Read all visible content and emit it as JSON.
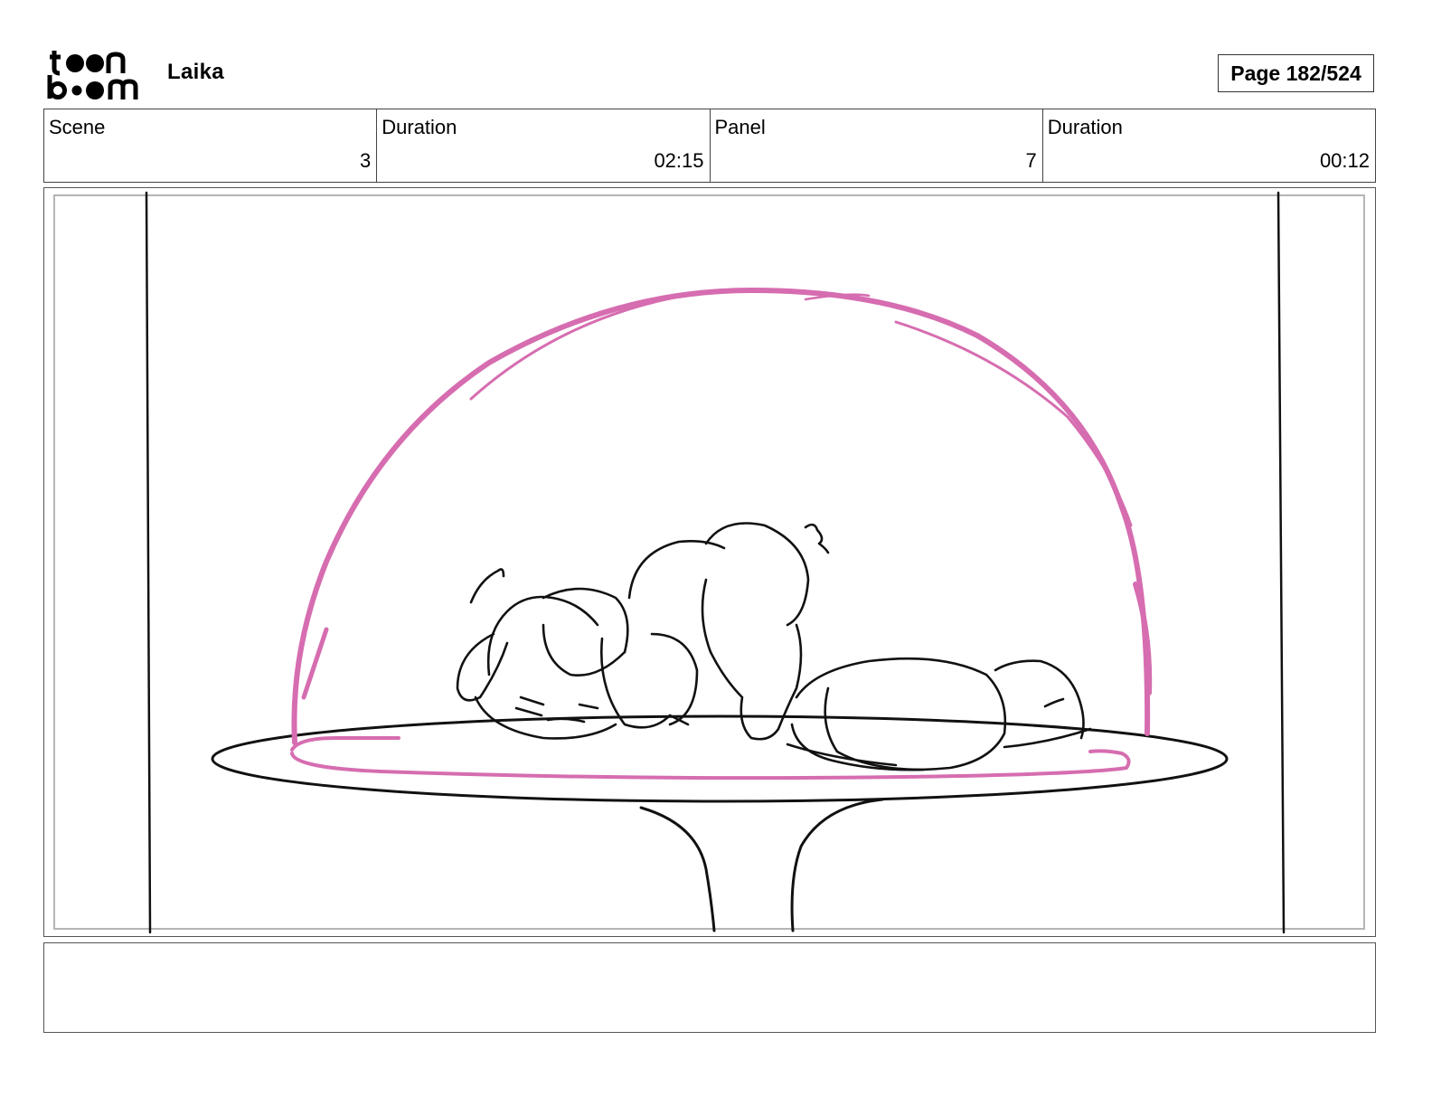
{
  "header": {
    "logo_text_top": "toon",
    "logo_text_bottom": "boom",
    "project_title": "Laika",
    "page_label": "Page 182/524"
  },
  "info_bar": [
    {
      "label": "Scene",
      "value": "3"
    },
    {
      "label": "Duration",
      "value": "02:15"
    },
    {
      "label": "Panel",
      "value": "7"
    },
    {
      "label": "Duration",
      "value": "00:12"
    }
  ],
  "panel": {
    "dome_color": "#d66db0",
    "line_color": "#111111"
  },
  "notes": {
    "text": ""
  }
}
